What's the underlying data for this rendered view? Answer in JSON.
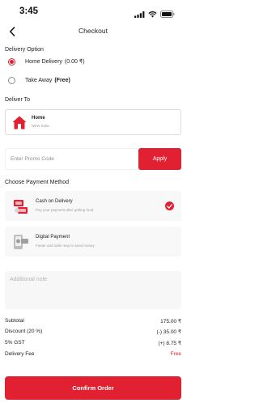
{
  "status_bar": {
    "time": "3:45"
  },
  "header": {
    "title": "Checkout"
  },
  "delivery_option": {
    "title": "Delivery Option",
    "options": [
      {
        "label": "Home Delivery",
        "value": "(0.00 ₹)",
        "selected": true
      },
      {
        "label": "Take Away",
        "value": "(Free)",
        "selected": false
      }
    ]
  },
  "deliver_to": {
    "title": "Deliver To",
    "address_title": "Home",
    "address_sub": "NEW India"
  },
  "promo": {
    "placeholder": "Enter Promo Code",
    "apply_label": "Apply"
  },
  "payment": {
    "title": "Choose Payment Method",
    "methods": [
      {
        "title": "Cash on Delivery",
        "subtitle": "Pay your payment after getting food",
        "selected": true
      },
      {
        "title": "Digital Payment",
        "subtitle": "Faster and safer way to send money",
        "selected": false
      }
    ]
  },
  "note": {
    "placeholder": "Additional note"
  },
  "summary": {
    "subtotal_label": "Subtotal",
    "subtotal_value": "175.00 ₹",
    "discount_label": "Discount (20 %)",
    "discount_value": "(-) 35.00 ₹",
    "gst_label": "5% GST",
    "gst_value": "(+) 8.75 ₹",
    "delivery_label": "Delivery Fee",
    "delivery_value": "Free"
  },
  "confirm_label": "Confirm Order",
  "colors": {
    "accent": "#e12031",
    "text": "#222222",
    "muted": "#9a9a9a",
    "card_bg": "#f8f8f8"
  },
  "icons": [
    "signal-icon",
    "wifi-icon",
    "battery-icon",
    "back-arrow-icon",
    "home-icon",
    "cash-icon",
    "digital-payment-icon",
    "check-icon"
  ]
}
